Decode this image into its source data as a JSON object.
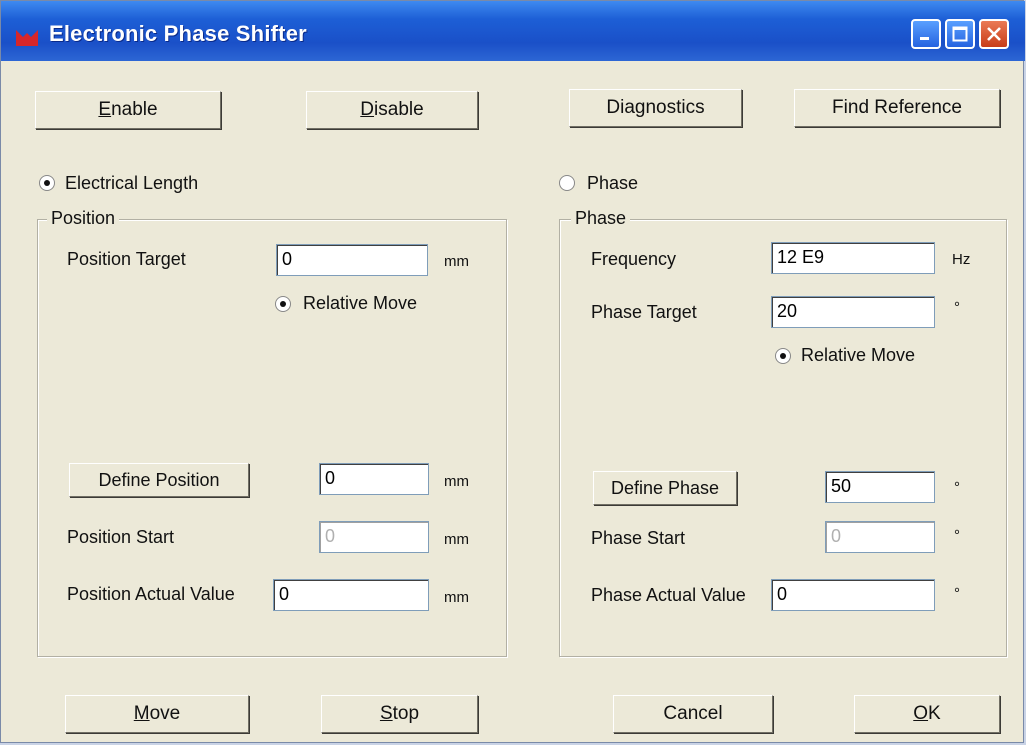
{
  "window": {
    "title": "Electronic Phase Shifter"
  },
  "toolbar": {
    "enable": {
      "mnemonic": "E",
      "rest": "nable"
    },
    "disable": {
      "mnemonic": "D",
      "rest": "isable"
    },
    "diagnostics": "Diagnostics",
    "find_reference": "Find Reference"
  },
  "left": {
    "mode_label": "Electrical Length",
    "mode_selected": true,
    "group_title": "Position",
    "target_label": "Position Target",
    "target_value": "0",
    "unit": "mm",
    "relative_move_label": "Relative Move",
    "define_button": "Define Position",
    "define_value": "0",
    "start_label": "Position Start",
    "start_value": "0",
    "actual_label": "Position Actual Value",
    "actual_value": "0"
  },
  "right": {
    "mode_label": "Phase",
    "mode_selected": false,
    "group_title": "Phase",
    "frequency_label": "Frequency",
    "frequency_value": "12 E9",
    "frequency_unit": "Hz",
    "target_label": "Phase Target",
    "target_value": "20",
    "degree_unit": "°",
    "relative_move_label": "Relative Move",
    "define_button": "Define Phase",
    "define_value": "50",
    "start_label": "Phase Start",
    "start_value": "0",
    "actual_label": "Phase Actual Value",
    "actual_value": "0"
  },
  "footer": {
    "move": {
      "mnemonic": "M",
      "rest": "ove"
    },
    "stop": {
      "mnemonic": "S",
      "rest": "top"
    },
    "cancel": "Cancel",
    "ok": {
      "mnemonic": "O",
      "rest": "K"
    }
  },
  "icons": {
    "app": "app-icon",
    "minimize": "minimize-icon",
    "maximize": "maximize-icon",
    "close": "close-icon"
  },
  "colors": {
    "titlebar": "#1d5fd6",
    "dialog_bg": "#ece9d8",
    "close_button": "#c83d18"
  }
}
